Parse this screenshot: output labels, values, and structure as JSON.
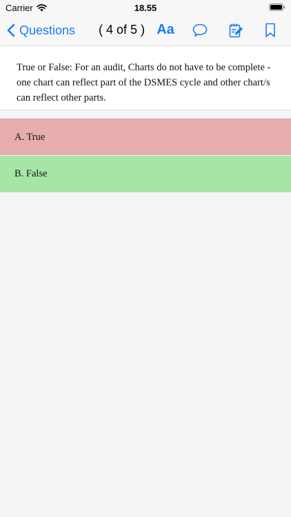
{
  "status": {
    "carrier": "Carrier",
    "time": "18.55"
  },
  "nav": {
    "back_label": "Questions",
    "counter": "( 4 of 5 )",
    "font_icon_label": "Aa",
    "accent_color": "#1a7bf2"
  },
  "question": {
    "text": "True or False: For an audit, Charts do not have to be complete - one chart can reflect part of the DSMES cycle and other chart/s can reflect other parts."
  },
  "options": [
    {
      "label": "A. True",
      "color": "#e5adad"
    },
    {
      "label": "B. False",
      "color": "#a6e5a6"
    }
  ],
  "icons": {
    "back": "chevron-left-icon",
    "font": "font-size-icon",
    "comment": "speech-bubble-icon",
    "note": "notepad-pencil-icon",
    "bookmark": "bookmark-icon",
    "wifi": "wifi-icon",
    "battery": "battery-icon"
  }
}
